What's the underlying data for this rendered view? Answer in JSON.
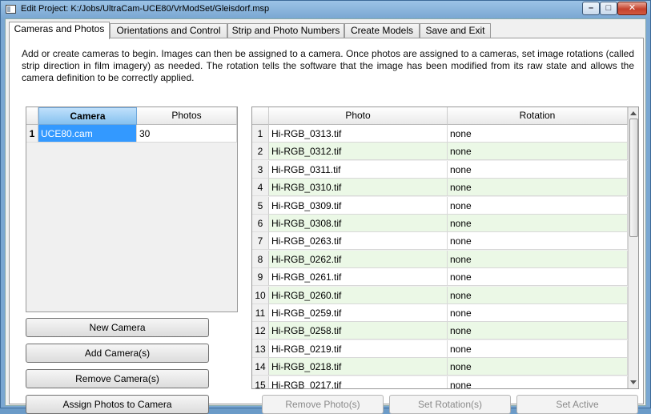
{
  "window": {
    "title": "Edit Project:  K:/Jobs/UltraCam-UCE80/VrModSet/Gleisdorf.msp",
    "controls": {
      "minimize": "–",
      "maximize": "□",
      "close": "✕"
    }
  },
  "tabs": [
    {
      "label": "Cameras and Photos"
    },
    {
      "label": "Orientations and Control"
    },
    {
      "label": "Strip and Photo Numbers"
    },
    {
      "label": "Create Models"
    },
    {
      "label": "Save and Exit"
    }
  ],
  "intro_text": "Add or create cameras to begin.  Images can then be assigned to a camera.  Once photos are assigned to a cameras, set image rotations (called strip direction in film imagery) as needed.  The rotation tells the software that the image has been modified from its raw state and allows the camera definition to be correctly applied.",
  "camera_table": {
    "headers": [
      "Camera",
      "Photos"
    ],
    "rows": [
      {
        "num": "1",
        "camera": "UCE80.cam",
        "photos": "30"
      }
    ]
  },
  "photo_table": {
    "headers": [
      "Photo",
      "Rotation"
    ],
    "rows": [
      {
        "num": "1",
        "photo": "Hi-RGB_0313.tif",
        "rotation": "none"
      },
      {
        "num": "2",
        "photo": "Hi-RGB_0312.tif",
        "rotation": "none"
      },
      {
        "num": "3",
        "photo": "Hi-RGB_0311.tif",
        "rotation": "none"
      },
      {
        "num": "4",
        "photo": "Hi-RGB_0310.tif",
        "rotation": "none"
      },
      {
        "num": "5",
        "photo": "Hi-RGB_0309.tif",
        "rotation": "none"
      },
      {
        "num": "6",
        "photo": "Hi-RGB_0308.tif",
        "rotation": "none"
      },
      {
        "num": "7",
        "photo": "Hi-RGB_0263.tif",
        "rotation": "none"
      },
      {
        "num": "8",
        "photo": "Hi-RGB_0262.tif",
        "rotation": "none"
      },
      {
        "num": "9",
        "photo": "Hi-RGB_0261.tif",
        "rotation": "none"
      },
      {
        "num": "10",
        "photo": "Hi-RGB_0260.tif",
        "rotation": "none"
      },
      {
        "num": "11",
        "photo": "Hi-RGB_0259.tif",
        "rotation": "none"
      },
      {
        "num": "12",
        "photo": "Hi-RGB_0258.tif",
        "rotation": "none"
      },
      {
        "num": "13",
        "photo": "Hi-RGB_0219.tif",
        "rotation": "none"
      },
      {
        "num": "14",
        "photo": "Hi-RGB_0218.tif",
        "rotation": "none"
      },
      {
        "num": "15",
        "photo": "Hi-RGB_0217.tif",
        "rotation": "none"
      }
    ]
  },
  "camera_buttons": {
    "new_camera": "New Camera",
    "add_cameras": "Add Camera(s)",
    "remove_cameras": "Remove Camera(s)",
    "assign_photos": "Assign Photos to Camera"
  },
  "photo_buttons": {
    "remove_photos": "Remove Photo(s)",
    "set_rotations": "Set Rotation(s)",
    "set_active": "Set Active"
  },
  "colors": {
    "selection": "#3399ff",
    "alt_row": "#ebf8e6",
    "title_bar": "#7aa7d2"
  }
}
